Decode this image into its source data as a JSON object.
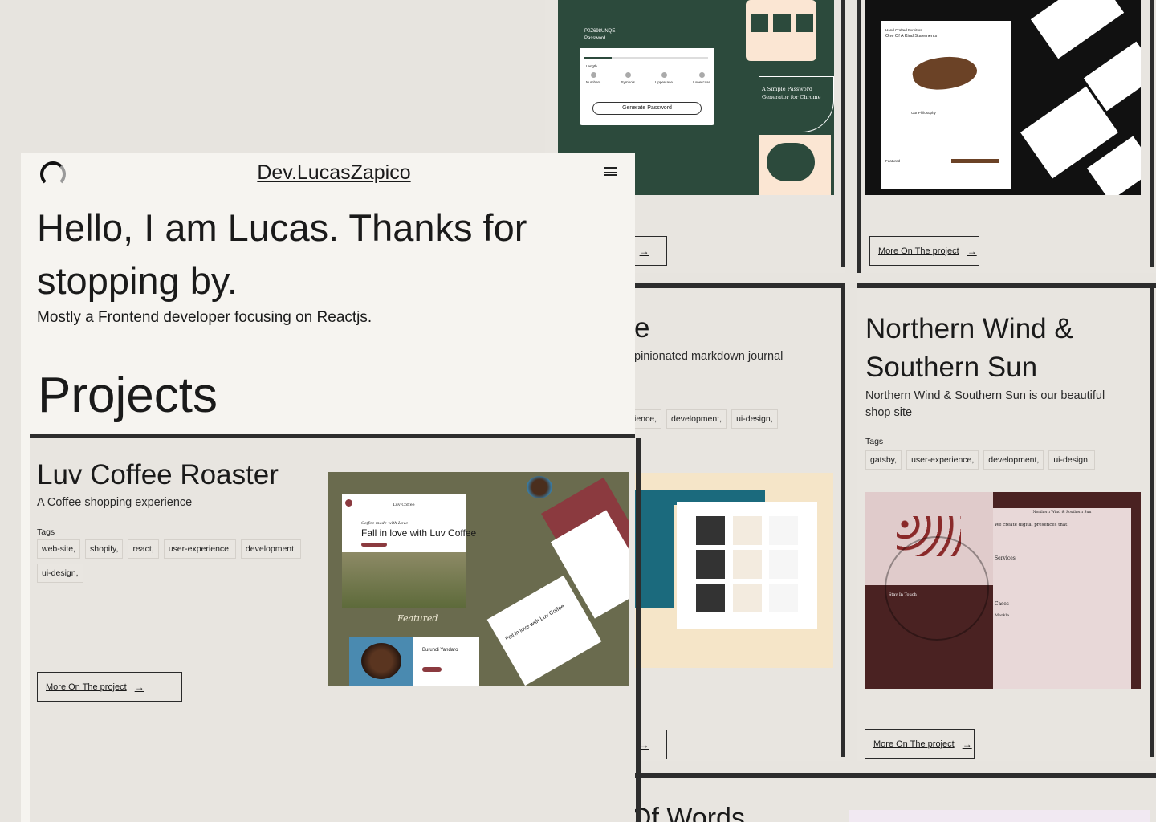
{
  "site": {
    "name": "Dev.LucasZapico",
    "menu_icon": "hamburger-icon"
  },
  "hero": {
    "greeting": "Hello, I am Lucas. Thanks for stopping by.",
    "subtitle": "Mostly a Frontend developer focusing on Reactjs."
  },
  "projects_heading": "Projects",
  "more_label": "More On The project",
  "tags_label": "Tags",
  "projects": [
    {
      "title": "Luv Coffee Roaster",
      "description": "A Coffee shopping experience",
      "tags": [
        "web-site,",
        "shopify,",
        "react,",
        "user-experience,",
        "development,",
        "ui-design,"
      ],
      "shot": {
        "brand": "Luv Coffee",
        "tagline": "Coffee made with Love",
        "headline": "Fall in love with Luv Coffee",
        "featured": "Featured",
        "product": "Burundi Yandaro",
        "diag": "Fall in love with Luv Coffee"
      }
    },
    {
      "title": "e",
      "description": "pinionated markdown journal",
      "tags": [
        "ience,",
        "development,",
        "ui-design,"
      ]
    },
    {
      "title": "Northern Wind & Southern Sun",
      "description": "Northern Wind & Southern Sun is our beautiful shop site",
      "tags": [
        "gatsby,",
        "user-experience,",
        "development,",
        "ui-design,"
      ],
      "shot": {
        "header": "Northern Wind & Southern Sun",
        "blurb": "We create digital presences that",
        "services": "Services",
        "touch": "Stay In Touch",
        "cases": "Cases",
        "case1": "Markle"
      }
    },
    {
      "title": "Of Words"
    }
  ],
  "password_shot": {
    "generated": "P0Z698UNQE",
    "field_label": "Password",
    "length_label": "Length",
    "options": [
      "Numbers",
      "Symbols",
      "Uppercase",
      "Lowercase"
    ],
    "button": "Generate Password",
    "side_title": "A Simple Password Generator for Chrome"
  },
  "furniture_shot": {
    "kicker": "Hand Crafted Furniture",
    "headline": "One Of A Kind Statements",
    "philosophy": "Our Philosophy",
    "featured": "Featured"
  },
  "partial_button_text": "ct"
}
